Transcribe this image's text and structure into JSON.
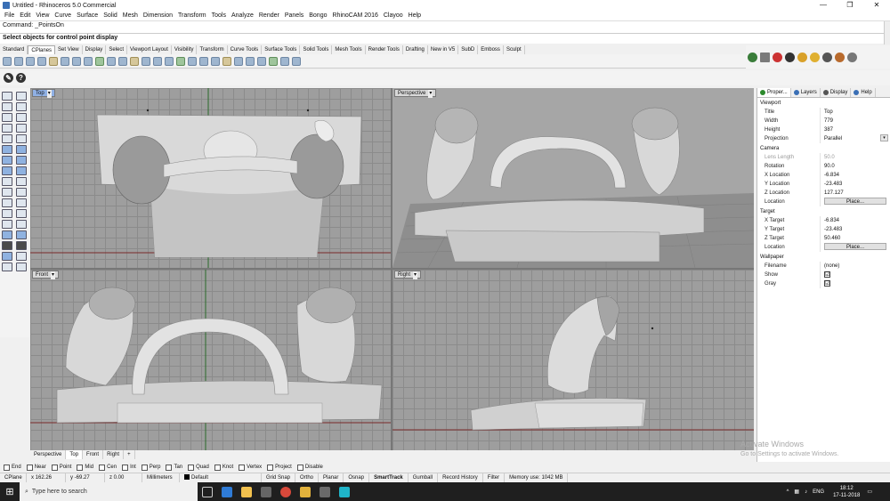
{
  "window": {
    "title": "Untitled - Rhinoceros 5.0 Commercial",
    "min": "—",
    "max": "❐",
    "close": "✕"
  },
  "menus": [
    "File",
    "Edit",
    "View",
    "Curve",
    "Surface",
    "Solid",
    "Mesh",
    "Dimension",
    "Transform",
    "Tools",
    "Analyze",
    "Render",
    "Panels",
    "Bongo",
    "RhinoCAM 2016",
    "Clayoo",
    "Help"
  ],
  "command": {
    "history": "Command: _PointsOn",
    "prompt": "Select objects for control point display"
  },
  "toolbar_tabs": [
    "Standard",
    "CPlanes",
    "Set View",
    "Display",
    "Select",
    "Viewport Layout",
    "Visibility",
    "Transform",
    "Curve Tools",
    "Surface Tools",
    "Solid Tools",
    "Mesh Tools",
    "Render Tools",
    "Drafting",
    "New in V5",
    "SubD",
    "Emboss",
    "Sculpt"
  ],
  "active_toolbar_tab": "CPlanes",
  "viewports": {
    "top": {
      "label": "Top"
    },
    "perspective": {
      "label": "Perspective"
    },
    "front": {
      "label": "Front"
    },
    "right": {
      "label": "Right"
    },
    "menu_glyph": "▾"
  },
  "viewport_tabs": [
    "Perspective",
    "Top",
    "Front",
    "Right",
    "+"
  ],
  "active_viewport_tab": "Top",
  "osnaps": [
    "End",
    "Near",
    "Point",
    "Mid",
    "Cen",
    "Int",
    "Perp",
    "Tan",
    "Quad",
    "Knot",
    "Vertex",
    "Project",
    "Disable"
  ],
  "status": {
    "cplane": "CPlane",
    "x": "x 162.26",
    "y": "y -69.27",
    "z": "z 0.00",
    "units": "Millimeters",
    "layer": "Default",
    "toggles": [
      "Grid Snap",
      "Ortho",
      "Planar",
      "Osnap",
      "SmartTrack",
      "Gumball",
      "Record History",
      "Filter"
    ],
    "memory": "Memory use: 1042 MB"
  },
  "properties": {
    "tabs": [
      "Proper...",
      "Layers",
      "Display",
      "Help"
    ],
    "viewport_section": "Viewport",
    "viewport_rows": [
      {
        "k": "Title",
        "v": "Top"
      },
      {
        "k": "Width",
        "v": "779"
      },
      {
        "k": "Height",
        "v": "387"
      },
      {
        "k": "Projection",
        "v": "Parallel"
      }
    ],
    "camera_section": "Camera",
    "camera_rows": [
      {
        "k": "Lens Length",
        "v": "50.0"
      },
      {
        "k": "Rotation",
        "v": "90.0"
      },
      {
        "k": "X Location",
        "v": "-6.834"
      },
      {
        "k": "Y Location",
        "v": "-23.483"
      },
      {
        "k": "Z Location",
        "v": "127.127"
      }
    ],
    "location_label": "Location",
    "place_button": "Place...",
    "target_section": "Target",
    "target_rows": [
      {
        "k": "X Target",
        "v": "-6.834"
      },
      {
        "k": "Y Target",
        "v": "-23.483"
      },
      {
        "k": "Z Target",
        "v": "50.460"
      }
    ],
    "wallpaper_section": "Wallpaper",
    "wallpaper_rows": [
      {
        "k": "Filename",
        "v": "(none)"
      },
      {
        "k": "Show",
        "v": "☑"
      },
      {
        "k": "Gray",
        "v": "☑"
      }
    ]
  },
  "taskbar": {
    "search_placeholder": "Type here to search",
    "lang": "ENG",
    "time": "18:12",
    "date": "17-11-2018"
  },
  "watermark": {
    "line1": "Activate Windows",
    "line2": "Go to Settings to activate Windows."
  }
}
